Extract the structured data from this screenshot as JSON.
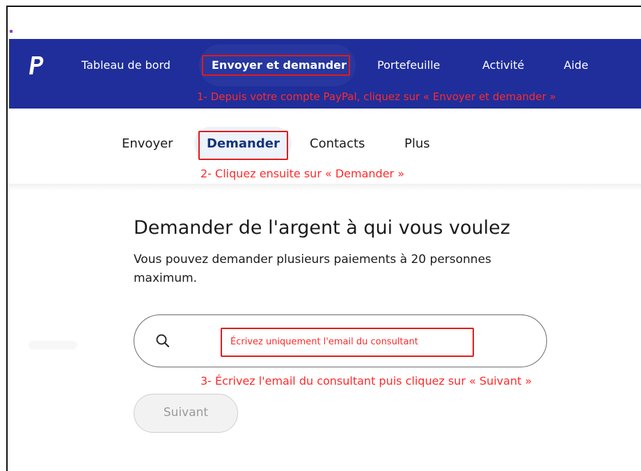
{
  "topnav": {
    "items": [
      {
        "label": "Tableau de bord"
      },
      {
        "label": "Envoyer et demander"
      },
      {
        "label": "Portefeuille"
      },
      {
        "label": "Activité"
      },
      {
        "label": "Aide"
      }
    ],
    "annotation": "1- Depuis votre compte PayPal, cliquez sur « Envoyer et demander »"
  },
  "subnav": {
    "items": [
      {
        "label": "Envoyer"
      },
      {
        "label": "Demander"
      },
      {
        "label": "Contacts"
      },
      {
        "label": "Plus"
      }
    ],
    "annotation": "2- Cliquez ensuite sur « Demander »"
  },
  "main": {
    "title": "Demander de l'argent à qui vous voulez",
    "description": "Vous pouvez demander plusieurs paiements à 20 personnes maximum.",
    "search_overlay": "Écrivez uniquement l'email du consultant",
    "annotation": "3- Écrivez l'email du consultant puis cliquez sur « Suivant »",
    "next_button": "Suivant"
  },
  "colors": {
    "nav_bg": "#1f2e9a",
    "annotation_red": "#ff2a2a",
    "active_subnav": "#14347a"
  },
  "icons": {
    "logo": "paypal-logo",
    "search": "search-icon"
  }
}
